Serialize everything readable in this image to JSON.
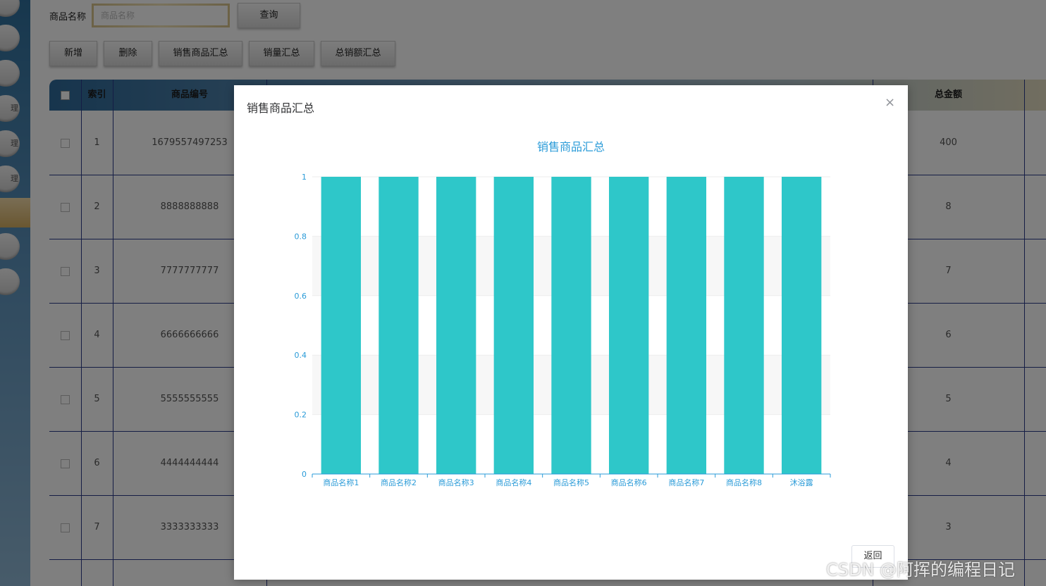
{
  "search": {
    "label": "商品名称",
    "placeholder": "商品名称",
    "button": "查询"
  },
  "toolbar": {
    "add": "新增",
    "delete": "删除",
    "sales_summary": "销售商品汇总",
    "quantity_summary": "销量汇总",
    "amount_summary": "总销额汇总"
  },
  "sidebar": {
    "items": [
      {
        "label": ""
      },
      {
        "label": ""
      },
      {
        "label": ""
      },
      {
        "label": "理"
      },
      {
        "label": "理"
      },
      {
        "label": "理"
      },
      {
        "label": ""
      },
      {
        "label": ""
      }
    ]
  },
  "table": {
    "headers": {
      "index": "索引",
      "code": "商品编号",
      "total": "总金额"
    },
    "rows": [
      {
        "index": "1",
        "code": "1679557497253",
        "total": "400"
      },
      {
        "index": "2",
        "code": "8888888888",
        "total": "8"
      },
      {
        "index": "3",
        "code": "7777777777",
        "total": "7"
      },
      {
        "index": "4",
        "code": "6666666666",
        "total": "6"
      },
      {
        "index": "5",
        "code": "5555555555",
        "total": "5"
      },
      {
        "index": "6",
        "code": "4444444444",
        "total": "4"
      },
      {
        "index": "7",
        "code": "3333333333",
        "total": "3"
      }
    ]
  },
  "dialog": {
    "title": "销售商品汇总",
    "close_icon": "close-icon",
    "return_button": "返回"
  },
  "chart_data": {
    "type": "bar",
    "title": "销售商品汇总",
    "categories": [
      "商品名称1",
      "商品名称2",
      "商品名称3",
      "商品名称4",
      "商品名称5",
      "商品名称6",
      "商品名称7",
      "商品名称8",
      "沐浴露"
    ],
    "values": [
      1,
      1,
      1,
      1,
      1,
      1,
      1,
      1,
      1
    ],
    "yticks": [
      "0",
      "0.2",
      "0.4",
      "0.6",
      "0.8",
      "1"
    ],
    "ylim": [
      0,
      1
    ],
    "grid": true,
    "colors": {
      "bar": "#2ec7c9",
      "axis": "#2a9bd8",
      "title": "#2a9bd8"
    }
  },
  "watermark": "CSDN @阿挥的编程日记"
}
